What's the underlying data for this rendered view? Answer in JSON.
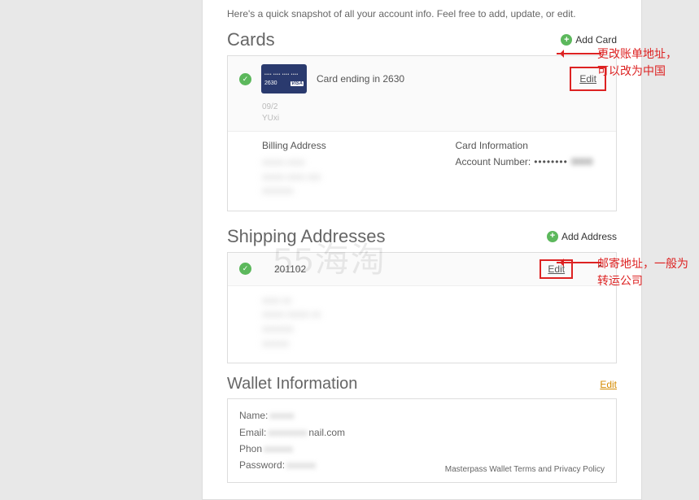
{
  "intro": "Here's a quick snapshot of all your account info. Feel free to add, update, or edit.",
  "cards": {
    "title": "Cards",
    "add_label": "Add Card",
    "item": {
      "label": "Card ending in 2630",
      "edit": "Edit",
      "exp": "09/2",
      "name": "YUxi",
      "last4": "2630",
      "brand": "VISA"
    },
    "details": {
      "billing_title": "Billing Address",
      "billing_blur": "xxxxx xxxx\nxxxxx xxxx xxx\nxxxxxxx",
      "cardinfo_title": "Card Information",
      "acct_label": "Account Number:",
      "acct_mask": "••••••••",
      "acct_last": "0000"
    }
  },
  "shipping": {
    "title": "Shipping Addresses",
    "add_label": "Add Address",
    "item": {
      "code": "201102",
      "edit": "Edit"
    },
    "addr_blur": "xxxx xx\nxxxxx xxxxx xx\nxxxxxxx\nxxxxxx"
  },
  "wallet": {
    "title": "Wallet Information",
    "edit": "Edit",
    "fields": {
      "name_label": "Name:",
      "name_val": "xxxxx",
      "email_label": "Email:",
      "email_blur": "xxxxxxxx",
      "email_suffix": "nail.com",
      "phone_label": "Phon",
      "phone_val": "xxxxxx",
      "password_label": "Password:",
      "password_val": "xxxxxx"
    },
    "legal_prefix": "Masterpass Wallet ",
    "legal_terms": "Terms",
    "legal_and": " and ",
    "legal_privacy": "Privacy Policy"
  },
  "annotations": {
    "a1_l1": "更改账单地址，",
    "a1_l2": "可以改为中国",
    "a2_l1": "邮寄地址，一般为",
    "a2_l2": "转运公司"
  },
  "watermark": "55海淘"
}
